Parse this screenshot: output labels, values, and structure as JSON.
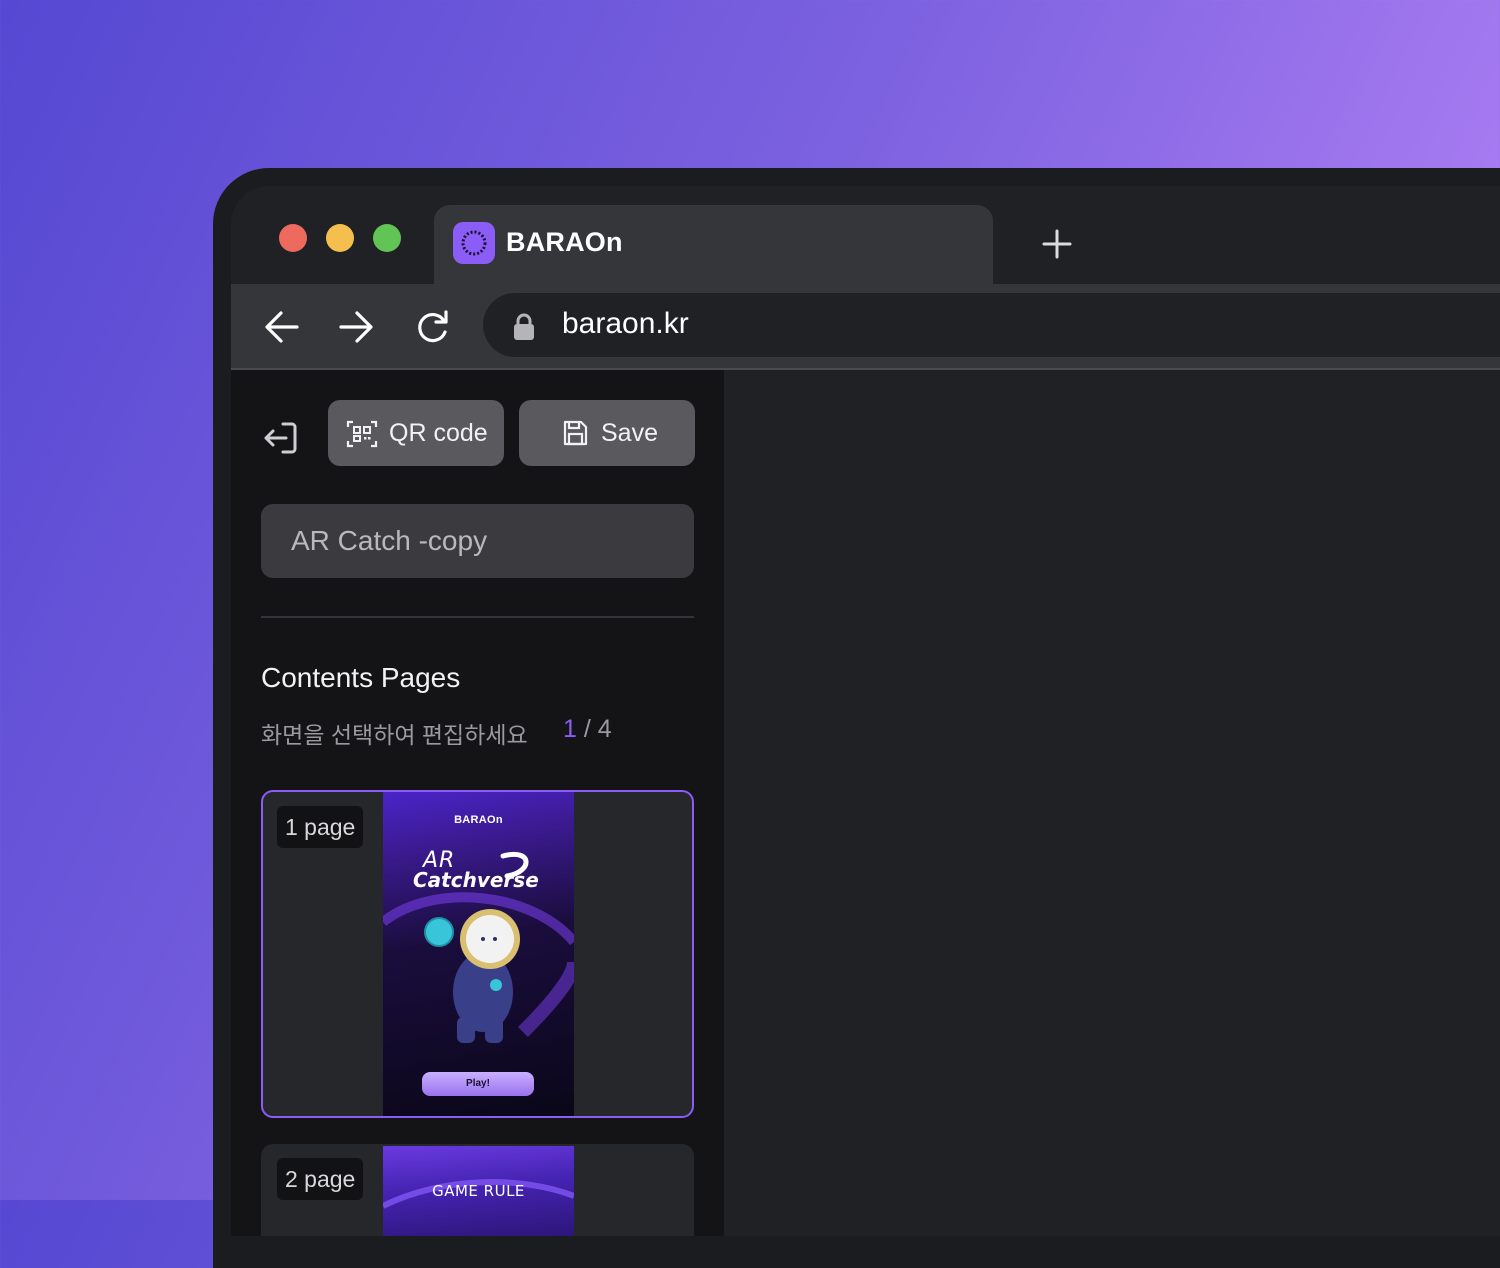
{
  "browser": {
    "tab_title": "BARAOn",
    "url": "baraon.kr"
  },
  "editor": {
    "qr_label": "QR code",
    "save_label": "Save",
    "project_name": "AR Catch -copy",
    "section_title": "Contents Pages",
    "hint": "화면을 선택하여 편집하세요",
    "current_page": "1",
    "total_pages": "/ 4",
    "pages": [
      {
        "label": "1 page",
        "brand": "BARAOn",
        "title_line1": "AR",
        "title_line2": "Catchverse",
        "button": "Play!"
      },
      {
        "label": "2 page",
        "heading": "GAME RULE"
      }
    ]
  },
  "colors": {
    "accent": "#8b5cf6",
    "close": "#ee6a5f",
    "minimize": "#f4bf4f",
    "maximize": "#61c454"
  }
}
